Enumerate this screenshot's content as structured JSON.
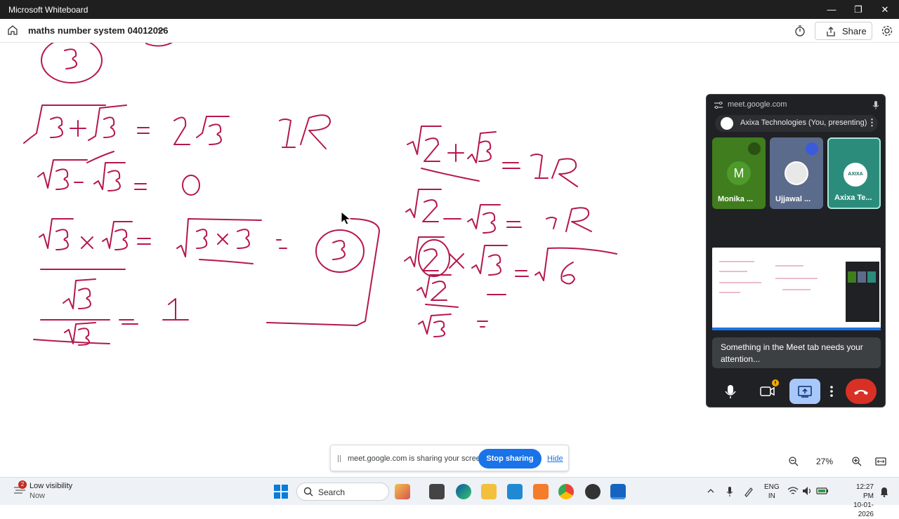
{
  "window": {
    "title": "Microsoft Whiteboard",
    "minimize": "—",
    "restore": "❐",
    "close": "✕"
  },
  "toolbar": {
    "board_name": "maths number system 04012026",
    "share_label": "Share"
  },
  "whiteboard": {
    "ink_color": "#b5174f",
    "notes": [
      "√3 + √3 = 2√3  IR",
      "√3 − √3 = 0",
      "√3 × √3 = √(3×3) = 3",
      "√3 / √3 = 1",
      "√2 + √3 = IR",
      "√2 − √3 = IR",
      "√2 × √3 = √6",
      "√2 / √3 ="
    ]
  },
  "meet": {
    "url": "meet.google.com",
    "presenting_label": "Axixa Technologies (You, presenting)",
    "participants": [
      {
        "name": "Monika ...",
        "initial": "M",
        "color": "#3f7d1f",
        "muted": true
      },
      {
        "name": "Ujjawal ...",
        "initial": "",
        "color": "#5b6b8c",
        "muted": true
      },
      {
        "name": "Axixa Te...",
        "initial": "AXIXA",
        "color": "#2c8c7c",
        "muted": false
      }
    ],
    "attention_text": "Something in the Meet tab needs your attention...",
    "accent": "#1a73e8",
    "end_color": "#d93025"
  },
  "sharing_banner": {
    "message": "meet.google.com is sharing your screen.",
    "stop_label": "Stop sharing",
    "hide_label": "Hide"
  },
  "zoom": {
    "level": "27%"
  },
  "taskbar": {
    "weather_title": "Low visibility",
    "weather_sub": "Now",
    "notification_count": "2",
    "search_label": "Search",
    "lang_line1": "ENG",
    "lang_line2": "IN",
    "time": "12:27 PM",
    "date": "10-01-2026"
  }
}
